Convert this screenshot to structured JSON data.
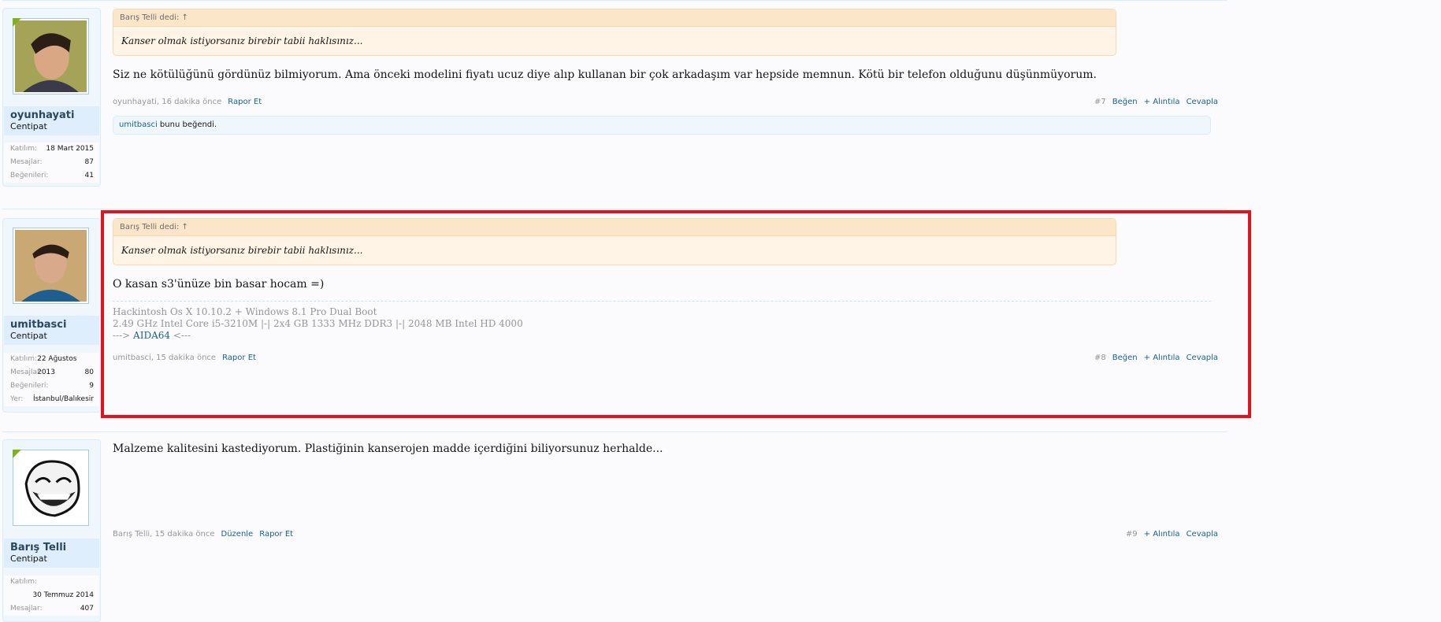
{
  "posts": [
    {
      "user": {
        "name": "oyunhayati",
        "title": "Centipat",
        "stats": [
          {
            "k": "Katılım:",
            "v": "18 Mart 2015"
          },
          {
            "k": "Mesajlar:",
            "v": "87"
          },
          {
            "k": "Beğenileri:",
            "v": "41"
          }
        ]
      },
      "quote": {
        "head": "Barış Telli dedi: ↑",
        "body": "Kanser olmak istiyorsanız birebir tabii haklısınız..."
      },
      "message": "Siz ne kötülüğünü gördünüz bilmiyorum. Ama önceki modelini fiyatı ucuz diye alıp kullanan bir çok arkadaşım var hepside memnun. Kötü bir telefon olduğunu düşünmüyorum.",
      "meta": {
        "author_time": "oyunhayati, 16 dakika önce",
        "report": "Rapor Et"
      },
      "controls": {
        "num": "#7",
        "like": "Beğen",
        "quote": "+ Alıntıla",
        "reply": "Cevapla"
      },
      "likes": {
        "liker": "umitbasci",
        "text": " bunu beğendi."
      }
    },
    {
      "user": {
        "name": "umitbasci",
        "title": "Centipat",
        "stats": [
          {
            "k": "Katılım:",
            "v": "22 Ağustos 2013"
          },
          {
            "k": "Mesajlar:",
            "v": "80"
          },
          {
            "k": "Beğenileri:",
            "v": "9"
          },
          {
            "k": "Yer:",
            "v": "İstanbul/Balıkesir"
          }
        ]
      },
      "quote": {
        "head": "Barış Telli dedi: ↑",
        "body": "Kanser olmak istiyorsanız birebir tabii haklısınız..."
      },
      "message": "O kasan s3'ünüze bin basar hocam =)",
      "signature": {
        "line1": "Hackintosh Os X 10.10.2 + Windows 8.1 Pro Dual Boot",
        "line2": "2.49 GHz Intel Core i5-3210M |-| 2x4 GB 1333 MHz DDR3 |-| 2048 MB Intel HD 4000",
        "line3_pre": "---> ",
        "line3_link": "AIDA64",
        "line3_post": " <---"
      },
      "meta": {
        "author_time": "umitbasci, 15 dakika önce",
        "report": "Rapor Et"
      },
      "controls": {
        "num": "#8",
        "like": "Beğen",
        "quote": "+ Alıntıla",
        "reply": "Cevapla"
      }
    },
    {
      "user": {
        "name": "Barış Telli",
        "title": "Centipat",
        "stats": [
          {
            "k": "Katılım:",
            "v": ""
          },
          {
            "k": "",
            "v": "30 Temmuz 2014"
          },
          {
            "k": "Mesajlar:",
            "v": "407"
          }
        ]
      },
      "message": "Malzeme kalitesini kastediyorum. Plastiğinin kanserojen madde içerdiğini biliyorsunuz herhalde...",
      "meta": {
        "author_time": "Barış Telli, 15 dakika önce",
        "edit": "Düzenle",
        "report": "Rapor Et"
      },
      "controls": {
        "num": "#9",
        "quote": "+ Alıntıla",
        "reply": "Cevapla"
      }
    }
  ],
  "colors": {
    "link": "#176093",
    "highlight": "#e1141e",
    "quote_bg": "#fff4e5",
    "user_bg": "#dfeefc"
  }
}
